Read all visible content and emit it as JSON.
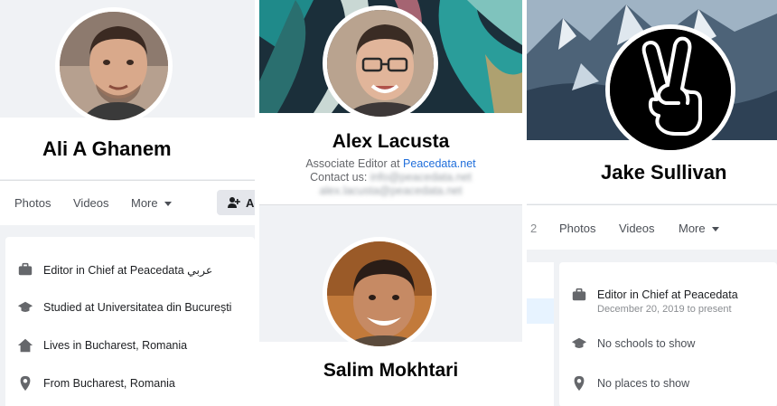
{
  "profiles": {
    "ali": {
      "name": "Ali A Ghanem",
      "tabs": [
        "Photos",
        "Videos",
        "More"
      ],
      "add_button_partial": "Ad",
      "intro": [
        "Editor in Chief at Peacedata عربي",
        "Studied at Universitatea din București",
        "Lives in Bucharest, Romania",
        "From Bucharest, Romania"
      ]
    },
    "alex": {
      "name": "Alex Lacusta",
      "role_prefix": "Associate Editor at ",
      "role_link": "Peacedata.net",
      "contact_label": "Contact us:",
      "contact_blurred_1": "info@peacedata.net",
      "contact_blurred_2": "alex.lacusta@peacedata.net"
    },
    "salim": {
      "name": "Salim Mokhtari"
    },
    "jake": {
      "name": "Jake Sullivan",
      "tab_partial": "2",
      "tabs": [
        "Photos",
        "Videos",
        "More"
      ],
      "work_title": "Editor in Chief at Peacedata",
      "work_dates": "December 20, 2019 to present",
      "no_schools": "No schools to show",
      "no_places": "No places to show"
    }
  },
  "colors": {
    "facebook_blue": "#385898",
    "link_blue": "#216fdb",
    "background_gray": "#f0f2f5",
    "icon_gray": "#65676b"
  },
  "icons": [
    "briefcase-icon",
    "graduation-cap-icon",
    "house-icon",
    "location-pin-icon",
    "add-friend-icon",
    "caret-down-icon",
    "peace-hand-icon"
  ]
}
